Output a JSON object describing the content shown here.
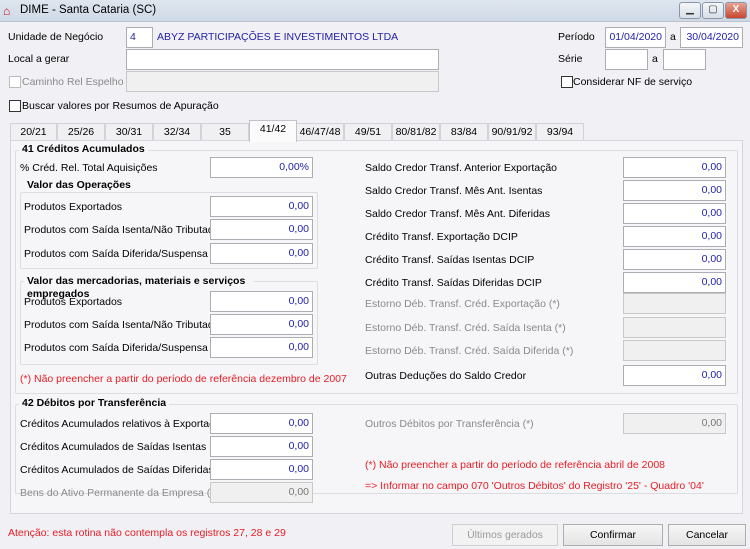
{
  "window": {
    "title": "DIME - Santa Cataria (SC)",
    "min": "▁",
    "max": "▢",
    "close": "X"
  },
  "header": {
    "unidade_label": "Unidade de Negócio",
    "unidade_value": "4",
    "unidade_name": "ABYZ PARTICIPAÇÕES E INVESTIMENTOS LTDA",
    "periodo_label": "Período",
    "periodo_from": "01/04/2020",
    "periodo_sep": "a",
    "periodo_to": "30/04/2020",
    "local_label": "Local a gerar",
    "local_value": "",
    "serie_label": "Série",
    "serie_from": "",
    "serie_sep": "a",
    "serie_to": "",
    "caminho_label": "Caminho Rel Espelho",
    "caminho_value": "",
    "considerar_label": "Considerar NF de serviço",
    "buscar_label": "Buscar valores por Resumos de Apuração"
  },
  "tabs": [
    "20/21",
    "25/26",
    "30/31",
    "32/34",
    "35",
    "41/42",
    "46/47/48",
    "49/51",
    "80/81/82",
    "83/84",
    "90/91/92",
    "93/94"
  ],
  "active_tab": "41/42",
  "g41": {
    "title": "41 Créditos Acumulados",
    "pct_label": "% Créd. Rel. Total Aquisições",
    "pct_value": "0,00%",
    "ops_title": "Valor das Operações",
    "ops": [
      {
        "label": "Produtos Exportados",
        "value": "0,00"
      },
      {
        "label": "Produtos com Saída Isenta/Não Tributada",
        "value": "0,00"
      },
      {
        "label": "Produtos com Saída Diferida/Suspensa",
        "value": "0,00"
      }
    ],
    "merc_title": "Valor das mercadorias, materiais e serviços empregados",
    "merc": [
      {
        "label": "Produtos Exportados",
        "value": "0,00"
      },
      {
        "label": "Produtos com Saída Isenta/Não Tributada",
        "value": "0,00"
      },
      {
        "label": "Produtos com Saída Diferida/Suspensa",
        "value": "0,00"
      }
    ],
    "note": "(*) Não preencher a partir do período de referência dezembro de 2007",
    "right": [
      {
        "label": "Saldo Credor Transf. Anterior Exportação",
        "value": "0,00"
      },
      {
        "label": "Saldo Credor Transf. Mês Ant. Isentas",
        "value": "0,00"
      },
      {
        "label": "Saldo Credor Transf. Mês Ant. Diferidas",
        "value": "0,00"
      },
      {
        "label": "Crédito Transf. Exportação DCIP",
        "value": "0,00"
      },
      {
        "label": "Crédito Transf. Saídas Isentas DCIP",
        "value": "0,00"
      },
      {
        "label": "Crédito Transf. Saídas Diferidas DCIP",
        "value": "0,00"
      },
      {
        "label": "Estorno Déb. Transf. Créd. Exportação (*)",
        "value": ""
      },
      {
        "label": "Estorno Déb. Transf. Créd. Saída Isenta (*)",
        "value": ""
      },
      {
        "label": "Estorno Déb. Transf. Créd. Saída Diferida (*)",
        "value": ""
      },
      {
        "label": "Outras Deduções do Saldo Credor",
        "value": "0,00"
      }
    ]
  },
  "g42": {
    "title": "42 Débitos por Transferência",
    "rows": [
      {
        "label": "Créditos Acumulados relativos à Exportação",
        "value": "0,00"
      },
      {
        "label": "Créditos Acumulados de Saídas Isentas",
        "value": "0,00"
      },
      {
        "label": "Créditos Acumulados de Saídas Diferidas",
        "value": "0,00"
      },
      {
        "label": "Bens do Ativo Permanente da Empresa (*)",
        "value": "0,00"
      }
    ],
    "outros_label": "Outros Débitos por Transferência (*)",
    "outros_value": "0,00",
    "note1": "(*) Não preencher a partir do período de referência abril de 2008",
    "note2": "=> Informar no campo 070 'Outros Débitos' do Registro '25' - Quadro '04'"
  },
  "footer": {
    "warning": "Atenção: esta rotina não contempla os registros 27, 28 e 29",
    "ultimos": "Últimos gerados",
    "confirmar": "Confirmar",
    "cancelar": "Cancelar"
  },
  "colors": {
    "accent_text": "#2222aa",
    "warning": "#e81c24"
  }
}
